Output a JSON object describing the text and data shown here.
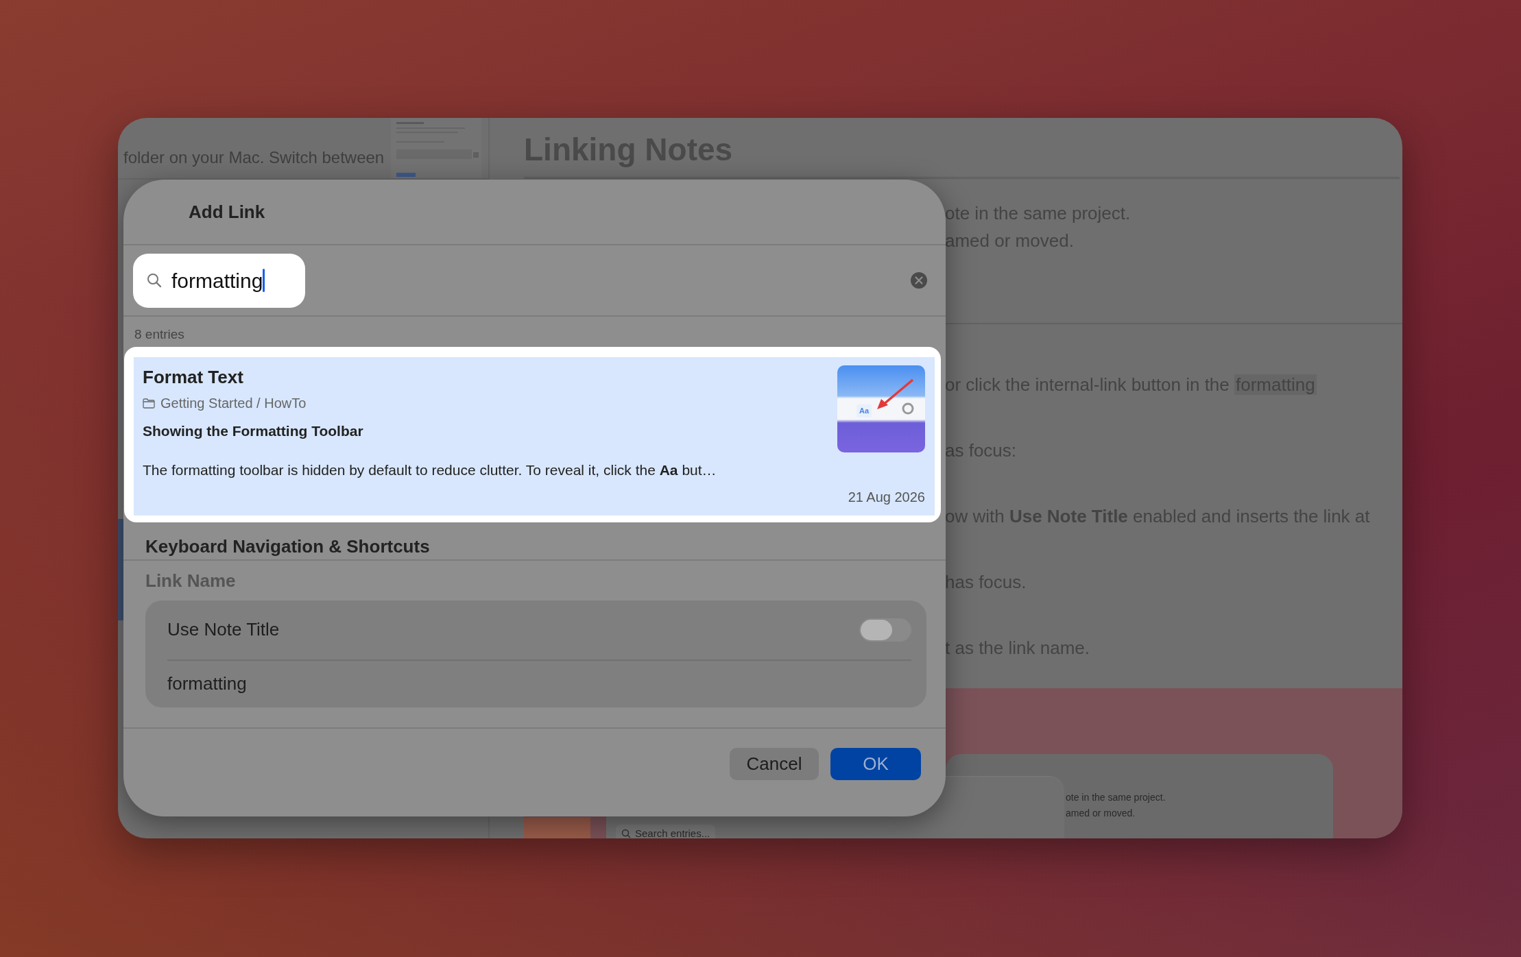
{
  "background_window": {
    "sidebar_text": "folder on your Mac. Switch between",
    "title": "Linking Notes",
    "paragraphs": [
      [
        {
          "text": "ote in the same project."
        },
        {
          "text": "amed or moved."
        }
      ],
      [
        {
          "text": " or click the internal-link button in the",
          "highlight": "formatting"
        },
        {
          "text": "as focus:"
        },
        {
          "text": "ow with **Use Note Title** enabled and inserts the link at"
        },
        {
          "text": "has focus."
        },
        {
          "text": "t as the link name."
        }
      ]
    ],
    "preview": {
      "lines": [
        "ote in the same project.",
        "amed or moved."
      ],
      "search_placeholder": "Search entries..."
    }
  },
  "dialog": {
    "title": "Add Link",
    "search": {
      "value": "formatting"
    },
    "count": "8 entries",
    "results": [
      {
        "title": "Format Text",
        "path": "Getting Started / HowTo",
        "heading": "Showing the Formatting Toolbar",
        "snippet": "The formatting toolbar is hidden by default to reduce clutter. To reveal it, click the **Aa** but…",
        "date": "21 Aug 2026",
        "selected": true,
        "thumbnail_label": "Aa"
      }
    ],
    "section_heading": "Keyboard Navigation & Shortcuts",
    "link_name": {
      "label": "Link Name",
      "toggle": {
        "label": "Use Note Title",
        "on": false
      },
      "value": "formatting"
    },
    "buttons": [
      {
        "label": "Cancel",
        "kind": "secondary"
      },
      {
        "label": "OK",
        "kind": "primary"
      }
    ]
  }
}
